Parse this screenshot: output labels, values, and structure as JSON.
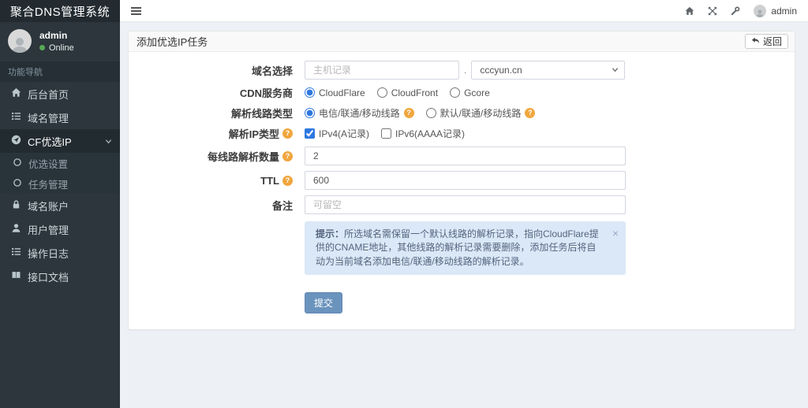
{
  "app": {
    "title": "聚合DNS管理系统"
  },
  "topbar": {
    "username": "admin"
  },
  "sidebar": {
    "user": {
      "name": "admin",
      "status": "Online"
    },
    "section_header": "功能导航",
    "items": [
      {
        "label": "后台首页"
      },
      {
        "label": "域名管理"
      },
      {
        "label": "CF优选IP",
        "children": [
          {
            "label": "优选设置"
          },
          {
            "label": "任务管理"
          }
        ]
      },
      {
        "label": "域名账户"
      },
      {
        "label": "用户管理"
      },
      {
        "label": "操作日志"
      },
      {
        "label": "接口文档"
      }
    ]
  },
  "page": {
    "card_title": "添加优选IP任务",
    "back_button_label": "返回",
    "form": {
      "domain": {
        "label": "域名选择",
        "host_placeholder": "主机记录",
        "separator": ".",
        "selected_domain": "cccyun.cn"
      },
      "cdn": {
        "label": "CDN服务商",
        "options": [
          {
            "label": "CloudFlare",
            "selected": true
          },
          {
            "label": "CloudFront",
            "selected": false
          },
          {
            "label": "Gcore",
            "selected": false
          }
        ]
      },
      "line_type": {
        "label": "解析线路类型",
        "options": [
          {
            "label": "电信/联通/移动线路",
            "selected": true
          },
          {
            "label": "默认/联通/移动线路",
            "selected": false
          }
        ]
      },
      "ip_type": {
        "label": "解析IP类型",
        "options": [
          {
            "label": "IPv4(A记录)",
            "checked": true
          },
          {
            "label": "IPv6(AAAA记录)",
            "checked": false
          }
        ]
      },
      "per_line_count": {
        "label": "每线路解析数量",
        "value": "2"
      },
      "ttl": {
        "label": "TTL",
        "value": "600"
      },
      "remark": {
        "label": "备注",
        "placeholder": "可留空"
      }
    },
    "alert": {
      "prefix": "提示：",
      "text": "所选域名需保留一个默认线路的解析记录，指向CloudFlare提供的CNAME地址，其他线路的解析记录需要删除，添加任务后将自动为当前域名添加电信/联通/移动线路的解析记录。",
      "close": "×"
    },
    "submit_label": "提交"
  },
  "colors": {
    "accent": "#2f78e0",
    "submit_button": "#6a93bd",
    "help_icon": "#f0a63e",
    "online_dot": "#57a957",
    "alert_bg": "#dbe8f7"
  }
}
